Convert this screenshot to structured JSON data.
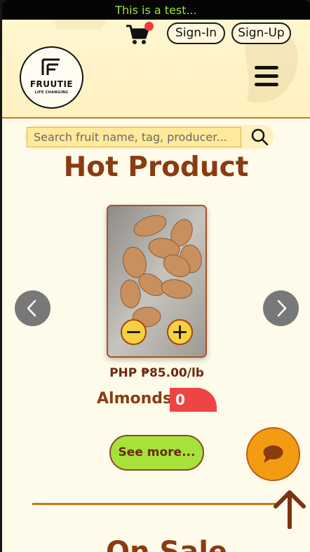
{
  "announcement": "This is a test...",
  "header": {
    "cart_badge_color": "#ef3b3b",
    "signin_label": "Sign-In",
    "signup_label": "Sign-Up",
    "logo": {
      "name": "FRUUTIE",
      "tagline": "LIFE CHANGING"
    }
  },
  "search": {
    "placeholder": "Search fruit name, tag, producer..."
  },
  "section_title": "Hot Product",
  "product": {
    "price": "PHP ₱85.00/lb",
    "name": "Almonds",
    "quantity": "0"
  },
  "see_more_label": "See more...",
  "next_section_title": "On Sale",
  "colors": {
    "accent": "#8a3b12",
    "announcement_text": "#9ce834",
    "button_green": "#a6e23a",
    "chat_orange": "#f39c12",
    "badge_red": "#ef4444"
  }
}
